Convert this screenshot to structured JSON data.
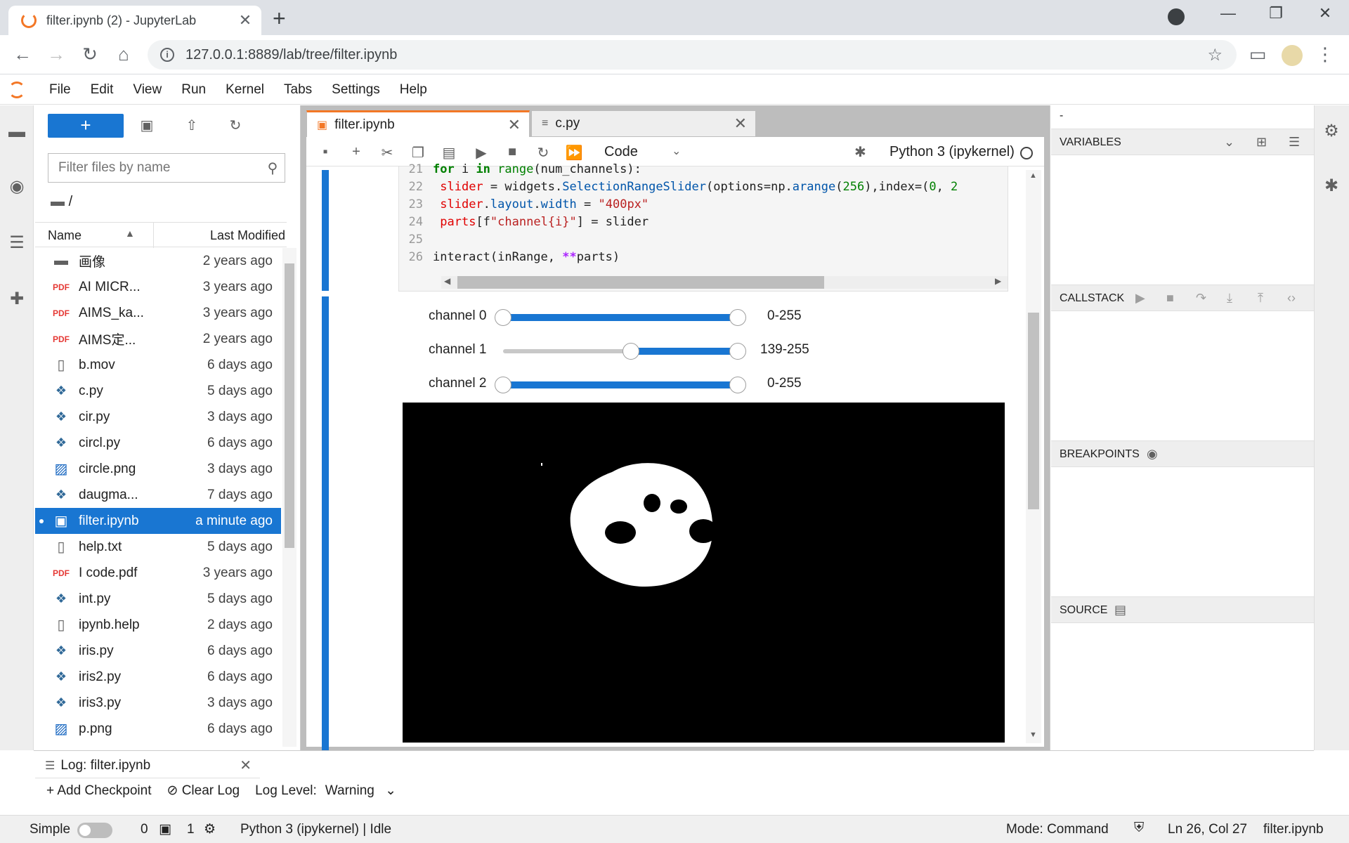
{
  "browser": {
    "tab_title": "filter.ipynb (2) - JupyterLab",
    "url": "127.0.0.1:8889/lab/tree/filter.ipynb"
  },
  "menu": [
    "File",
    "Edit",
    "View",
    "Run",
    "Kernel",
    "Tabs",
    "Settings",
    "Help"
  ],
  "filebrowser": {
    "filter_placeholder": "Filter files by name",
    "breadcrumb": "/",
    "col_name": "Name",
    "col_modified": "Last Modified",
    "files": [
      {
        "name": "画像",
        "modified": "2 years ago",
        "type": "folder"
      },
      {
        "name": "AI MICR...",
        "modified": "3 years ago",
        "type": "pdf"
      },
      {
        "name": "AIMS_ka...",
        "modified": "3 years ago",
        "type": "pdf"
      },
      {
        "name": "AIMS定...",
        "modified": "2 years ago",
        "type": "pdf"
      },
      {
        "name": "b.mov",
        "modified": "6 days ago",
        "type": "file"
      },
      {
        "name": "c.py",
        "modified": "5 days ago",
        "type": "py"
      },
      {
        "name": "cir.py",
        "modified": "3 days ago",
        "type": "py"
      },
      {
        "name": "circl.py",
        "modified": "6 days ago",
        "type": "py"
      },
      {
        "name": "circle.png",
        "modified": "3 days ago",
        "type": "img"
      },
      {
        "name": "daugma...",
        "modified": "7 days ago",
        "type": "py"
      },
      {
        "name": "filter.ipynb",
        "modified": "a minute ago",
        "type": "nb",
        "selected": true
      },
      {
        "name": "help.txt",
        "modified": "5 days ago",
        "type": "file"
      },
      {
        "name": "I code.pdf",
        "modified": "3 years ago",
        "type": "pdf"
      },
      {
        "name": "int.py",
        "modified": "5 days ago",
        "type": "py"
      },
      {
        "name": "ipynb.help",
        "modified": "2 days ago",
        "type": "file"
      },
      {
        "name": "iris.py",
        "modified": "6 days ago",
        "type": "py"
      },
      {
        "name": "iris2.py",
        "modified": "6 days ago",
        "type": "py"
      },
      {
        "name": "iris3.py",
        "modified": "3 days ago",
        "type": "py"
      },
      {
        "name": "p.png",
        "modified": "6 days ago",
        "type": "img"
      }
    ]
  },
  "doc_tabs": [
    {
      "label": "filter.ipynb",
      "active": true
    },
    {
      "label": "c.py",
      "active": false
    }
  ],
  "toolbar": {
    "cell_type": "Code",
    "kernel": "Python 3 (ipykernel)"
  },
  "code_lines": [
    {
      "n": "21",
      "text": "for i in range(num_channels):"
    },
    {
      "n": "22",
      "text": " slider = widgets.SelectionRangeSlider(options=np.arange(256),index=(0, 2"
    },
    {
      "n": "23",
      "text": " slider.layout.width = \"400px\""
    },
    {
      "n": "24",
      "text": " parts[f\"channel{i}\"] = slider"
    },
    {
      "n": "25",
      "text": ""
    },
    {
      "n": "26",
      "text": "interact(inRange, **parts)"
    }
  ],
  "sliders": [
    {
      "label": "channel 0",
      "value": "0-255",
      "lo": 0,
      "hi": 255
    },
    {
      "label": "channel 1",
      "value": "139-255",
      "lo": 139,
      "hi": 255
    },
    {
      "label": "channel 2",
      "value": "0-255",
      "lo": 0,
      "hi": 255
    }
  ],
  "debugger": {
    "variables": "VARIABLES",
    "callstack": "CALLSTACK",
    "breakpoints": "BREAKPOINTS",
    "source": "SOURCE",
    "top_label": "-"
  },
  "log": {
    "tab": "Log: filter.ipynb",
    "add_checkpoint": "Add Checkpoint",
    "clear_log": "Clear Log",
    "level_label": "Log Level:",
    "level": "Warning"
  },
  "status": {
    "mode_label": "Simple",
    "terminals": "0",
    "kernels": "1",
    "kernel_status": "Python 3 (ipykernel) | Idle",
    "mode": "Mode: Command",
    "position": "Ln 26, Col 27",
    "filename": "filter.ipynb"
  }
}
